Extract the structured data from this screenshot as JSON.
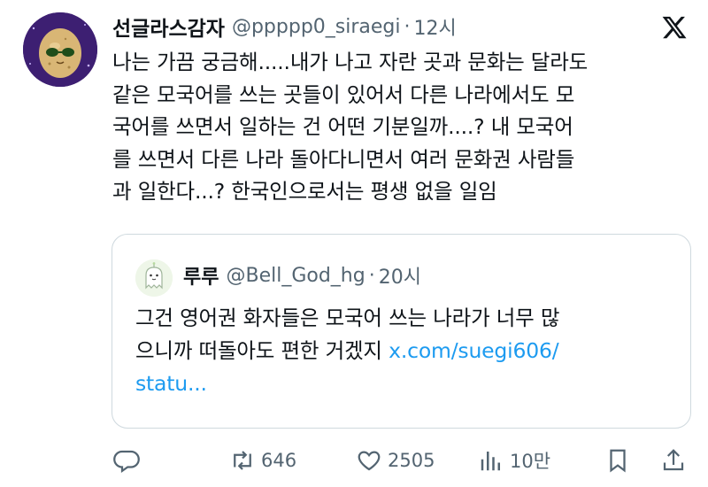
{
  "tweet": {
    "display_name": "선글라스감자",
    "handle": "@ppppp0_siraegi",
    "separator": "·",
    "time": "12시",
    "lines": [
      "나는 가끔 궁금해.....내가 나고 자란 곳과 문화는 달라도",
      "같은 모국어를 쓰는 곳들이 있어서 다른 나라에서도 모",
      "국어를 쓰면서 일하는 건 어떤 기분일까....? 내 모국어",
      "를 쓰면서 다른 나라 돌아다니면서 여러 문화권 사람들",
      "과 일한다...? 한국인으로서는 평생 없을 일임"
    ]
  },
  "quote": {
    "display_name": "루루",
    "handle": "@Bell_God_hg",
    "separator": "·",
    "time": "20시",
    "lines": [
      "그건 영어권 화자들은 모국어 쓰는 나라가 너무 많",
      "으니까 떠돌아도 편한 거겠지 "
    ],
    "link_part1": "x.com/suegi606/",
    "link_part2": "statu..."
  },
  "actions": {
    "reply_icon": "reply-icon",
    "retweet_count": "646",
    "like_count": "2505",
    "views_count": "10만",
    "bookmark_icon": "bookmark-icon",
    "share_icon": "share-icon"
  },
  "colors": {
    "text": "#0f1419",
    "secondary": "#536471",
    "link": "#1d9bf0",
    "border": "#cfd9de"
  }
}
